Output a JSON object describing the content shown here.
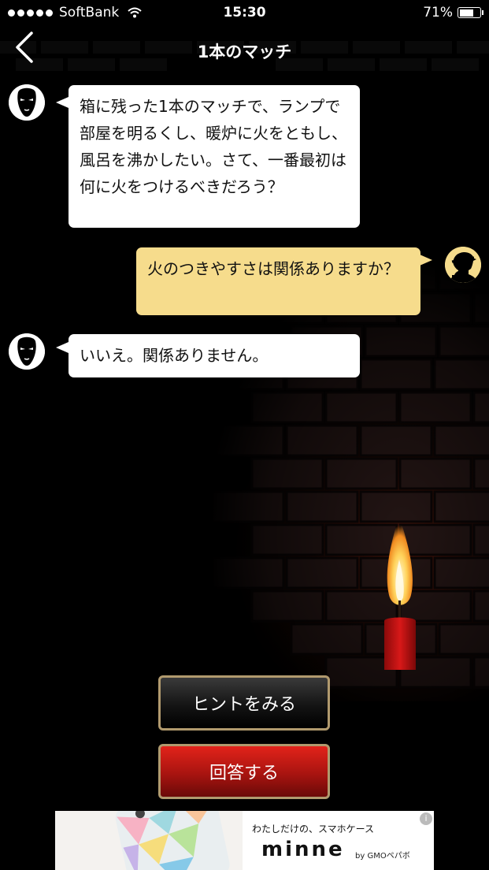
{
  "status_bar": {
    "carrier": "SoftBank",
    "time": "15:30",
    "battery_text": "71%",
    "battery_level": 0.71
  },
  "nav": {
    "title": "1本のマッチ"
  },
  "messages": [
    {
      "side": "left",
      "text": "箱に残った1本のマッチで、ランプで部屋を明るくし、暖炉に火をともし、風呂を沸かしたい。さて、一番最初は何に火をつけるべきだろう？"
    },
    {
      "side": "right",
      "text": "火のつきやすさは関係ありますか？"
    },
    {
      "side": "left",
      "text": "いいえ。関係ありません。"
    }
  ],
  "buttons": {
    "hint_label": "ヒントをみる",
    "answer_label": "回答する"
  },
  "ad": {
    "tagline": "わたしだけの、スマホケース",
    "brand": "minne",
    "by_text": "by GMOペパボ",
    "info_icon": "i"
  },
  "colors": {
    "background": "#000000",
    "left_bubble": "#ffffff",
    "right_bubble": "#f6dc8c",
    "hint_button": "#1e1e1e",
    "answer_button": "#c81c14",
    "button_border": "#b19a6e"
  }
}
